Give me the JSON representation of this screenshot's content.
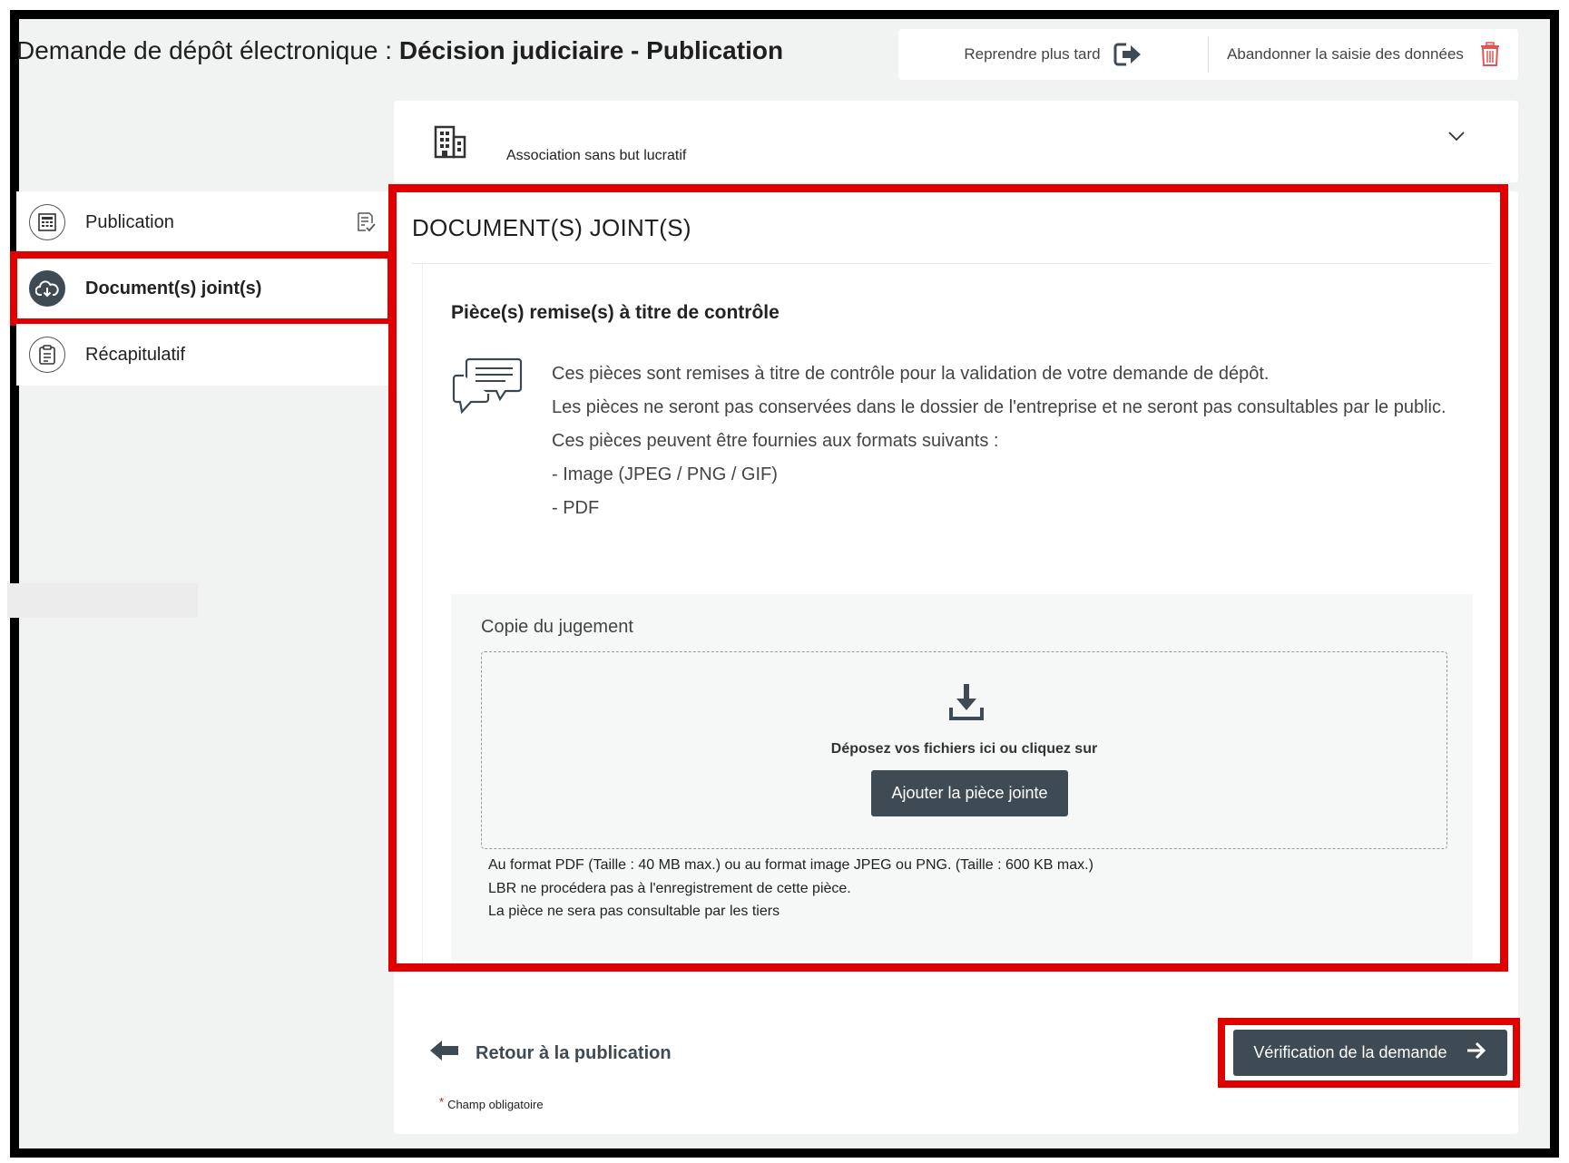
{
  "header": {
    "title_prefix": "Demande de dépôt électronique : ",
    "title_bold": "Décision judiciaire - Publication",
    "resume_label": "Reprendre plus tard",
    "abandon_label": "Abandonner la saisie des données"
  },
  "entity": {
    "label": "Association sans but lucratif"
  },
  "sidebar": {
    "items": [
      {
        "label": "Publication",
        "icon": "calculator-icon",
        "status_icon": "edit-check-icon"
      },
      {
        "label": "Document(s) joint(s)",
        "icon": "cloud-upload-icon",
        "active": true
      },
      {
        "label": "Récapitulatif",
        "icon": "clipboard-icon"
      }
    ]
  },
  "section": {
    "title": "DOCUMENT(S) JOINT(S)",
    "card_title": "Pièce(s) remise(s) à titre de contrôle",
    "info_lines": [
      "Ces pièces sont remises à titre de contrôle pour la validation de votre demande de dépôt.",
      "Les pièces ne seront pas conservées dans le dossier de l'entreprise et ne seront pas consultables par le public.",
      "Ces pièces peuvent être fournies aux formats suivants :",
      "- Image (JPEG / PNG / GIF)",
      "- PDF"
    ]
  },
  "upload": {
    "label": "Copie du jugement",
    "drop_text": "Déposez vos fichiers ici ou cliquez sur",
    "button_label": "Ajouter la pièce jointe",
    "notes": [
      "Au format PDF (Taille : 40 MB max.) ou au format image JPEG ou PNG. (Taille : 600 KB max.)",
      "LBR ne procédera pas à l'enregistrement de cette pièce.",
      "La pièce ne sera pas consultable par les tiers"
    ]
  },
  "footer": {
    "back_label": "Retour à la publication",
    "next_label": "Vérification de la demande",
    "required_label": "Champ obligatoire",
    "required_star": "*"
  },
  "colors": {
    "accent": "#3f4b54",
    "highlight": "#e10000",
    "background": "#f1f2f2"
  }
}
